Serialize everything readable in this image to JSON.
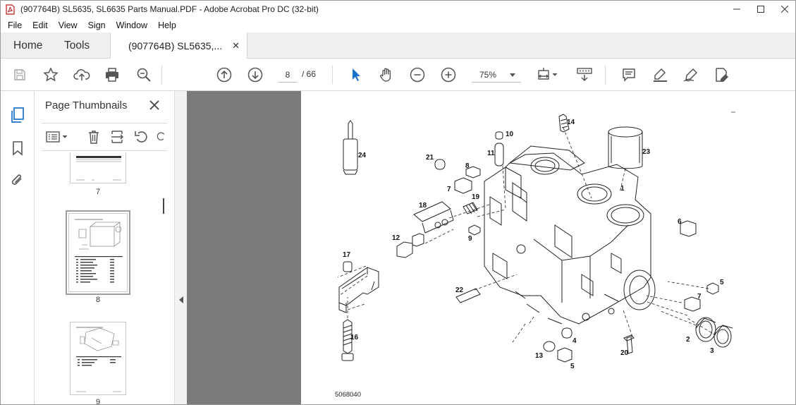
{
  "window": {
    "title": "(907764B) SL5635, SL6635 Parts Manual.PDF - Adobe Acrobat Pro DC (32-bit)",
    "app_icon": "acrobat-icon"
  },
  "menu": [
    "File",
    "Edit",
    "View",
    "Sign",
    "Window",
    "Help"
  ],
  "tabs": {
    "home": "Home",
    "tools": "Tools",
    "document": "(907764B) SL5635,..."
  },
  "toolbar": {
    "current_page": "8",
    "page_total": "/ 66",
    "zoom": "75%",
    "icons": [
      "save-icon",
      "bookmark-star-icon",
      "upload-icon",
      "print-icon",
      "search-zoom-icon",
      "prev-page-icon",
      "next-page-icon",
      "select-cursor-icon",
      "hand-icon",
      "zoom-out-icon",
      "zoom-in-icon",
      "page-fit-icon",
      "scroll-mode-icon",
      "comment-icon",
      "highlight-icon",
      "sign-icon",
      "edit-pdf-icon"
    ]
  },
  "sidebar_panel": {
    "title": "Page Thumbnails",
    "thumbnails": [
      {
        "label": "7"
      },
      {
        "label": "8",
        "selected": true
      },
      {
        "label": "9"
      }
    ]
  },
  "drawing": {
    "callouts": [
      "1",
      "2",
      "3",
      "4",
      "5",
      "5",
      "6",
      "7",
      "7",
      "8",
      "9",
      "10",
      "11",
      "12",
      "13",
      "14",
      "16",
      "17",
      "18",
      "19",
      "20",
      "21",
      "22",
      "23",
      "24"
    ],
    "figure_number": "5068040"
  },
  "colors": {
    "accent_blue": "#1a73c8",
    "doc_background": "#7b7b7b",
    "tab_bar": "#efefef"
  }
}
